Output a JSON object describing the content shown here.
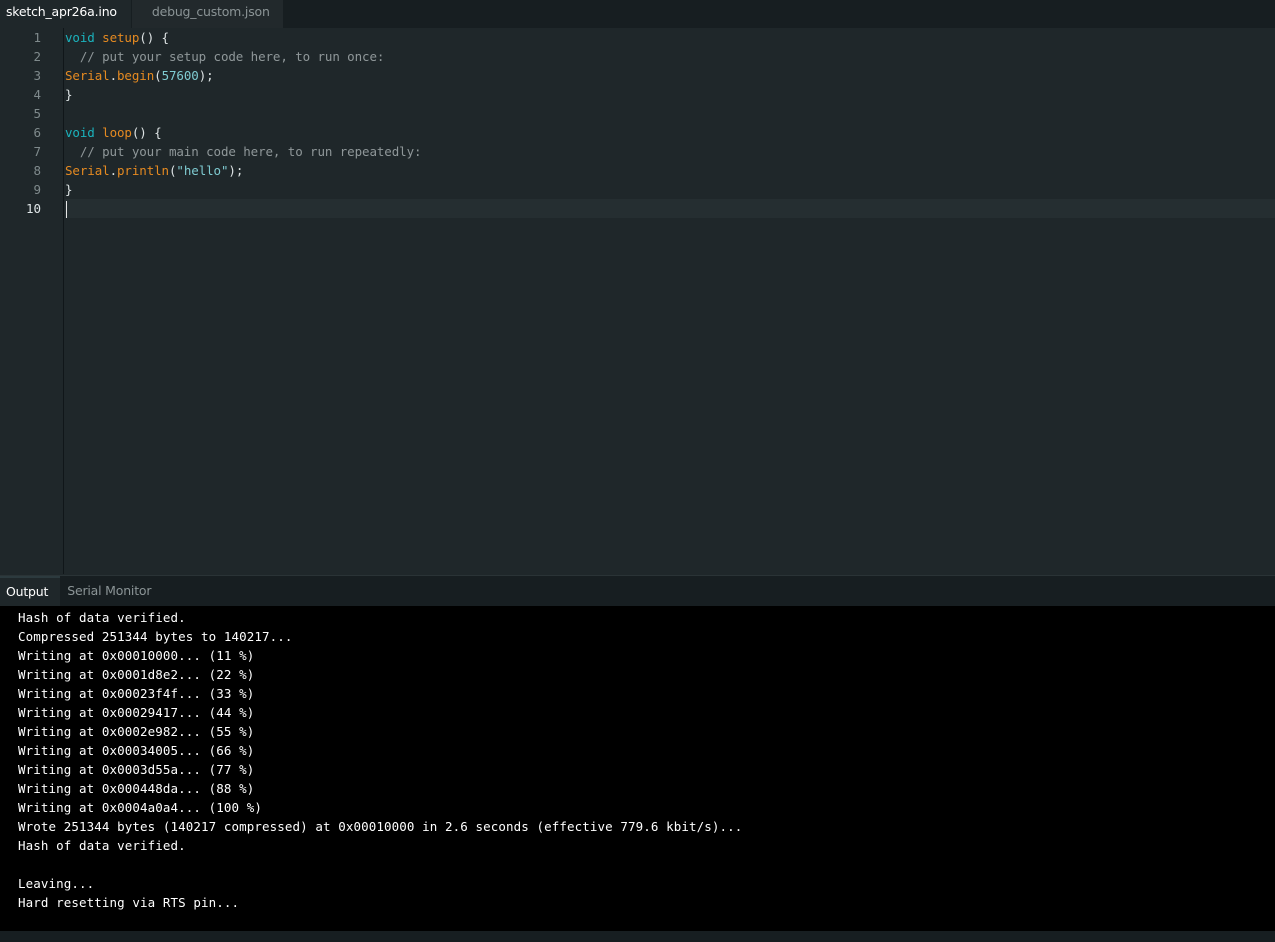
{
  "tabs": [
    {
      "label": "sketch_apr26a.ino",
      "active": true
    },
    {
      "label": "debug_custom.json",
      "active": false
    }
  ],
  "editor": {
    "line_numbers": [
      "1",
      "2",
      "3",
      "4",
      "5",
      "6",
      "7",
      "8",
      "9",
      "10"
    ],
    "current_line": 10,
    "lines": [
      [
        {
          "t": "kw",
          "v": "void"
        },
        {
          "t": "pl",
          "v": " "
        },
        {
          "t": "fn",
          "v": "setup"
        },
        {
          "t": "pl",
          "v": "() {"
        }
      ],
      [
        {
          "t": "cmt",
          "v": "  // put your setup code here, to run once:"
        }
      ],
      [
        {
          "t": "fn",
          "v": "Serial"
        },
        {
          "t": "pl",
          "v": "."
        },
        {
          "t": "fn",
          "v": "begin"
        },
        {
          "t": "pl",
          "v": "("
        },
        {
          "t": "num",
          "v": "57600"
        },
        {
          "t": "pl",
          "v": ");"
        }
      ],
      [
        {
          "t": "pl",
          "v": "}"
        }
      ],
      [],
      [
        {
          "t": "kw",
          "v": "void"
        },
        {
          "t": "pl",
          "v": " "
        },
        {
          "t": "fn",
          "v": "loop"
        },
        {
          "t": "pl",
          "v": "() {"
        }
      ],
      [
        {
          "t": "cmt",
          "v": "  // put your main code here, to run repeatedly:"
        }
      ],
      [
        {
          "t": "fn",
          "v": "Serial"
        },
        {
          "t": "pl",
          "v": "."
        },
        {
          "t": "fn",
          "v": "println"
        },
        {
          "t": "pl",
          "v": "("
        },
        {
          "t": "str",
          "v": "\"hello\""
        },
        {
          "t": "pl",
          "v": ");"
        }
      ],
      [
        {
          "t": "pl",
          "v": "}"
        }
      ],
      []
    ]
  },
  "output_tabs": [
    {
      "label": "Output",
      "active": true
    },
    {
      "label": "Serial Monitor",
      "active": false
    }
  ],
  "console": {
    "lines": [
      "Hash of data verified.",
      "Compressed 251344 bytes to 140217...",
      "Writing at 0x00010000... (11 %)",
      "Writing at 0x0001d8e2... (22 %)",
      "Writing at 0x00023f4f... (33 %)",
      "Writing at 0x00029417... (44 %)",
      "Writing at 0x0002e982... (55 %)",
      "Writing at 0x00034005... (66 %)",
      "Writing at 0x0003d55a... (77 %)",
      "Writing at 0x000448da... (88 %)",
      "Writing at 0x0004a0a4... (100 %)",
      "Wrote 251344 bytes (140217 compressed) at 0x00010000 in 2.6 seconds (effective 779.6 kbit/s)...",
      "Hash of data verified.",
      "",
      "Leaving...",
      "Hard resetting via RTS pin..."
    ]
  }
}
